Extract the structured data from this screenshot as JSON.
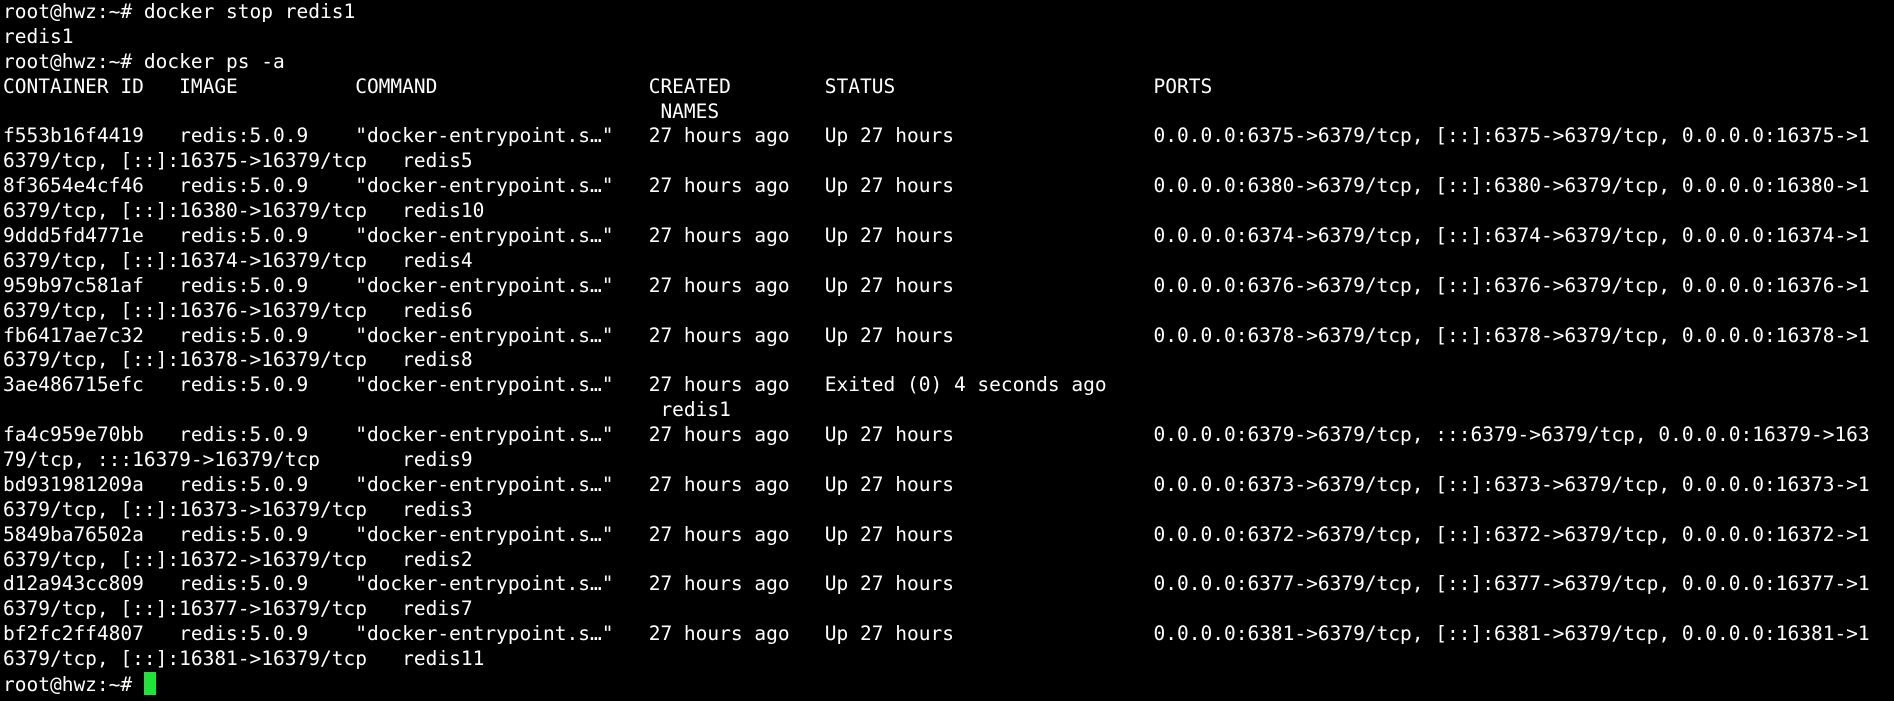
{
  "colors": {
    "background": "#000000",
    "foreground": "#ffffff",
    "cursor": "#22e33a"
  },
  "terminal": {
    "prompt": "root@hwz:~# ",
    "lines": [
      "root@hwz:~# docker stop redis1",
      "redis1",
      "root@hwz:~# docker ps -a",
      "CONTAINER ID   IMAGE          COMMAND                  CREATED        STATUS                      PORTS",
      "                                                        NAMES",
      "f553b16f4419   redis:5.0.9    \"docker-entrypoint.s…\"   27 hours ago   Up 27 hours                 0.0.0.0:6375->6379/tcp, [::]:6375->6379/tcp, 0.0.0.0:16375->1",
      "6379/tcp, [::]:16375->16379/tcp   redis5",
      "8f3654e4cf46   redis:5.0.9    \"docker-entrypoint.s…\"   27 hours ago   Up 27 hours                 0.0.0.0:6380->6379/tcp, [::]:6380->6379/tcp, 0.0.0.0:16380->1",
      "6379/tcp, [::]:16380->16379/tcp   redis10",
      "9ddd5fd4771e   redis:5.0.9    \"docker-entrypoint.s…\"   27 hours ago   Up 27 hours                 0.0.0.0:6374->6379/tcp, [::]:6374->6379/tcp, 0.0.0.0:16374->1",
      "6379/tcp, [::]:16374->16379/tcp   redis4",
      "959b97c581af   redis:5.0.9    \"docker-entrypoint.s…\"   27 hours ago   Up 27 hours                 0.0.0.0:6376->6379/tcp, [::]:6376->6379/tcp, 0.0.0.0:16376->1",
      "6379/tcp, [::]:16376->16379/tcp   redis6",
      "fb6417ae7c32   redis:5.0.9    \"docker-entrypoint.s…\"   27 hours ago   Up 27 hours                 0.0.0.0:6378->6379/tcp, [::]:6378->6379/tcp, 0.0.0.0:16378->1",
      "6379/tcp, [::]:16378->16379/tcp   redis8",
      "3ae486715efc   redis:5.0.9    \"docker-entrypoint.s…\"   27 hours ago   Exited (0) 4 seconds ago",
      "                                                        redis1",
      "fa4c959e70bb   redis:5.0.9    \"docker-entrypoint.s…\"   27 hours ago   Up 27 hours                 0.0.0.0:6379->6379/tcp, :::6379->6379/tcp, 0.0.0.0:16379->163",
      "79/tcp, :::16379->16379/tcp       redis9",
      "bd931981209a   redis:5.0.9    \"docker-entrypoint.s…\"   27 hours ago   Up 27 hours                 0.0.0.0:6373->6379/tcp, [::]:6373->6379/tcp, 0.0.0.0:16373->1",
      "6379/tcp, [::]:16373->16379/tcp   redis3",
      "5849ba76502a   redis:5.0.9    \"docker-entrypoint.s…\"   27 hours ago   Up 27 hours                 0.0.0.0:6372->6379/tcp, [::]:6372->6379/tcp, 0.0.0.0:16372->1",
      "6379/tcp, [::]:16372->16379/tcp   redis2",
      "d12a943cc809   redis:5.0.9    \"docker-entrypoint.s…\"   27 hours ago   Up 27 hours                 0.0.0.0:6377->6379/tcp, [::]:6377->6379/tcp, 0.0.0.0:16377->1",
      "6379/tcp, [::]:16377->16379/tcp   redis7",
      "bf2fc2ff4807   redis:5.0.9    \"docker-entrypoint.s…\"   27 hours ago   Up 27 hours                 0.0.0.0:6381->6379/tcp, [::]:6381->6379/tcp, 0.0.0.0:16381->1",
      "6379/tcp, [::]:16381->16379/tcp   redis11"
    ]
  }
}
